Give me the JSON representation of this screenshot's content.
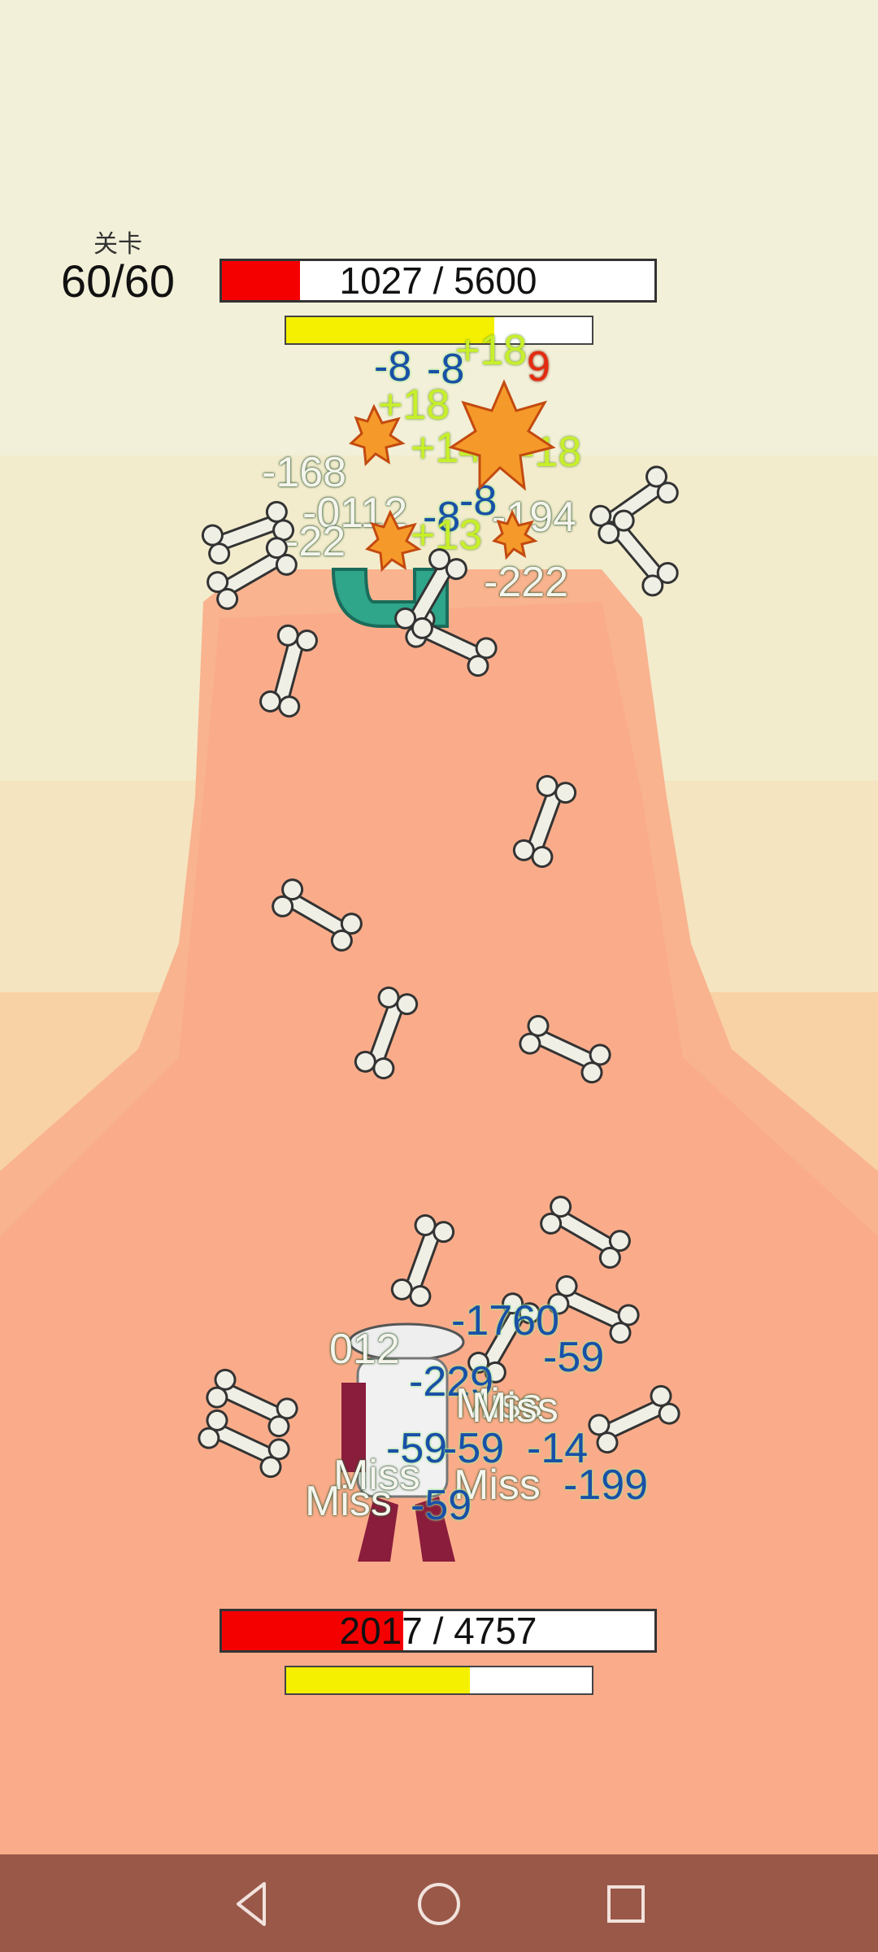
{
  "colors": {
    "hp_fill": "#f40000",
    "energy_fill": "#f5f000",
    "nav_bg": "#9a5848"
  },
  "level": {
    "label": "关卡",
    "value": "60/60"
  },
  "enemy": {
    "hp_text": "1027 / 5600",
    "hp_fraction": 0.18,
    "energy_fraction": 0.68
  },
  "player": {
    "hp_text": "2017 / 4757",
    "hp_fraction": 0.42,
    "energy_fraction": 0.6
  },
  "enemy_damage_texts": [
    "-8",
    "-8",
    "+18",
    "9",
    "+18",
    "+145",
    "-18",
    "-168",
    "-8",
    "-0112",
    "-8",
    "-194",
    "+13",
    "-22",
    "-222"
  ],
  "player_damage_texts": [
    "-1760",
    "012",
    "-59",
    "-229",
    "Miss",
    "Miss",
    "-59",
    "-14",
    "-59",
    "Miss",
    "Miss",
    "-199",
    "Miss",
    "-59"
  ],
  "nav": {
    "back": "back-icon",
    "home": "home-icon",
    "recents": "recents-icon"
  }
}
